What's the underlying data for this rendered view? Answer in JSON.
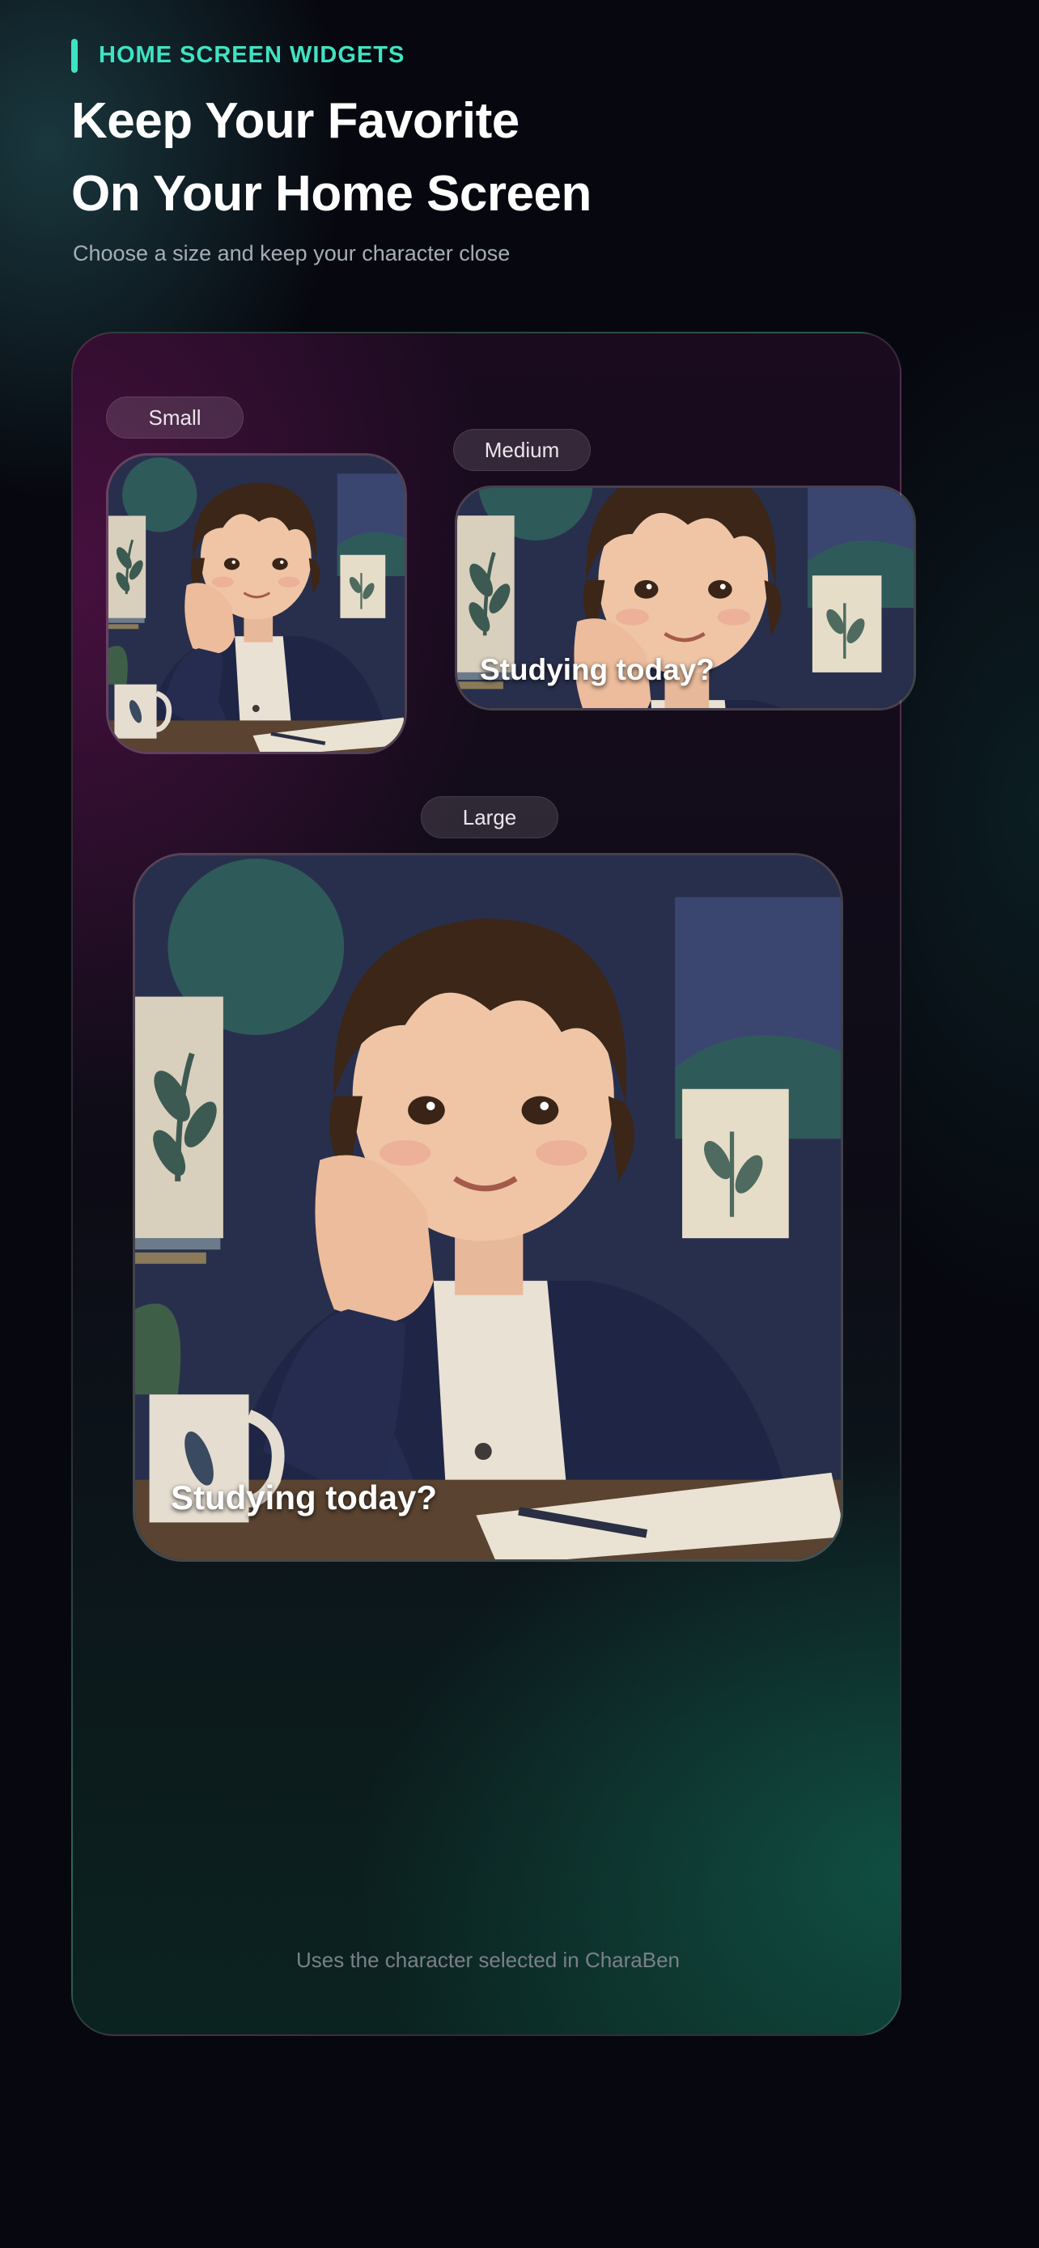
{
  "header": {
    "eyebrow": "HOME SCREEN WIDGETS",
    "title_line1": "Keep Your Favorite",
    "title_line2": "On Your Home Screen",
    "subtitle": "Choose a size and keep your character close"
  },
  "widgets": {
    "small": {
      "label": "Small"
    },
    "medium": {
      "label": "Medium",
      "caption": "Studying today?"
    },
    "large": {
      "label": "Large",
      "caption": "Studying today?"
    }
  },
  "footer": {
    "note": "Uses the character selected in CharaBen"
  },
  "colors": {
    "accent": "#3fe3c3",
    "background": "#07080f",
    "panel_pink": "#5a1450",
    "panel_teal": "#0f4a3e"
  }
}
